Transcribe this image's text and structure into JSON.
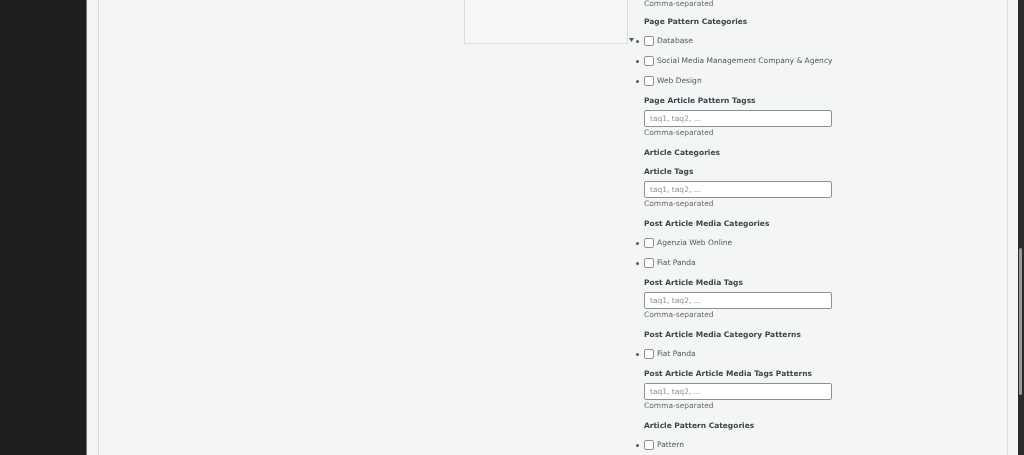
{
  "top_hint": "Comma-separated",
  "sections": [
    {
      "kind": "checkboxes",
      "heading": "Page Pattern Categories",
      "items": [
        {
          "label": "Database",
          "checked": false
        },
        {
          "label": "Social Media Management Company & Agency",
          "checked": false
        },
        {
          "label": "Web Design",
          "checked": false
        }
      ]
    },
    {
      "kind": "tags",
      "heading": "Page Article Pattern Tagss",
      "placeholder": "taq1, taq2, ...",
      "hint": "Comma-separated"
    },
    {
      "kind": "checkboxes",
      "heading": "Article Categories"
    },
    {
      "kind": "tags",
      "heading": "Article Tags",
      "placeholder": "taq1, taq2, ...",
      "hint": "Comma-separated"
    },
    {
      "kind": "checkboxes",
      "heading": "Post Article Media Categories",
      "items": [
        {
          "label": "Agenzia Web Online",
          "checked": false
        },
        {
          "label": "Fiat Panda",
          "checked": false
        }
      ]
    },
    {
      "kind": "tags",
      "heading": "Post Article Media Tags",
      "placeholder": "taq1, taq2, ...",
      "hint": "Comma-separated"
    },
    {
      "kind": "checkboxes",
      "heading": "Post Article Media Category Patterns",
      "items": [
        {
          "label": "Fiat Panda",
          "checked": false
        }
      ]
    },
    {
      "kind": "tags",
      "heading": "Post Article Article Media Tags Patterns",
      "placeholder": "taq1, taq2, ...",
      "hint": "Comma-separated"
    },
    {
      "kind": "checkboxes",
      "heading": "Article Pattern Categories",
      "items": [
        {
          "label": "Pattern",
          "checked": false
        }
      ]
    }
  ]
}
